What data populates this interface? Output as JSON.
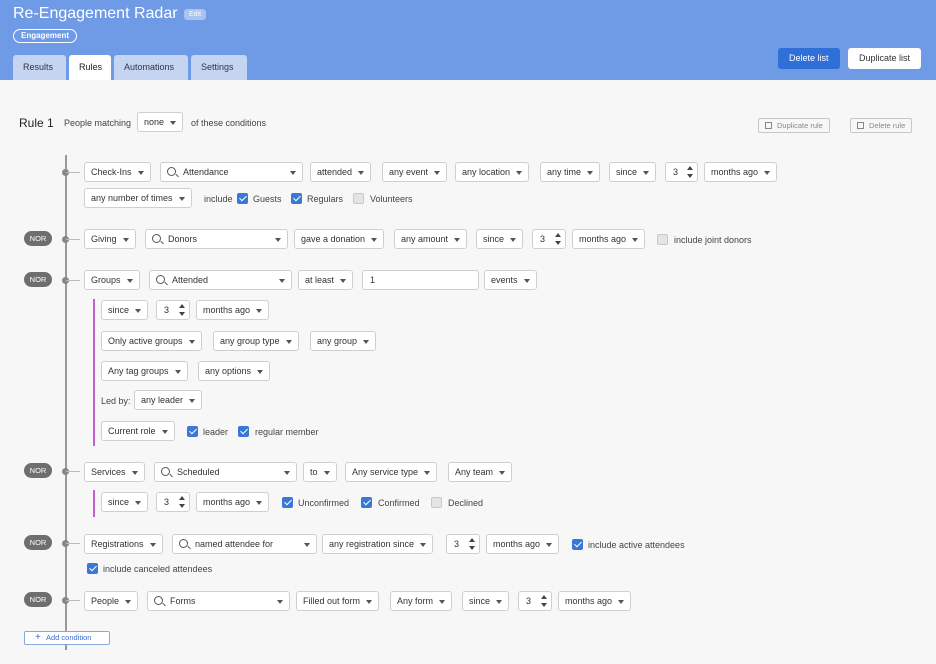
{
  "header": {
    "title": "Re-Engagement Radar",
    "edit_label": "Edit",
    "tag": "Engagement",
    "tabs": [
      "Results",
      "Rules",
      "Automations",
      "Settings"
    ],
    "delete_label": "Delete list",
    "duplicate_label": "Duplicate list"
  },
  "rule": {
    "title": "Rule 1",
    "matching_prefix": "People matching",
    "matching_value": "none",
    "matching_suffix": "of these conditions",
    "duplicate_rule": "Duplicate rule",
    "delete_rule": "Delete rule",
    "nor_label": "NOR"
  },
  "checkins": {
    "type": "Check-Ins",
    "search": "Attendance",
    "verb": "attended",
    "event": "any event",
    "location": "any location",
    "time": "any time",
    "since": "since",
    "num": "3",
    "unit": "months ago",
    "times": "any number of times",
    "include": "include",
    "guests": "Guests",
    "regulars": "Regulars",
    "volunteers": "Volunteers"
  },
  "giving": {
    "type": "Giving",
    "search": "Donors",
    "verb": "gave a donation",
    "amount": "any amount",
    "since": "since",
    "num": "3",
    "unit": "months ago",
    "joint": "include joint donors"
  },
  "groups": {
    "type": "Groups",
    "search": "Attended",
    "compare": "at least",
    "count": "1",
    "events": "events",
    "since": "since",
    "num": "3",
    "unit": "months ago",
    "active": "Only active groups",
    "group_type": "any group type",
    "group": "any group",
    "tag_groups": "Any tag groups",
    "options": "any options",
    "led_by": "Led by:",
    "leader_sel": "any leader",
    "role": "Current role",
    "leader": "leader",
    "member": "regular member"
  },
  "services": {
    "type": "Services",
    "search": "Scheduled",
    "to": "to",
    "service_type": "Any service type",
    "team": "Any team",
    "since": "since",
    "num": "3",
    "unit": "months ago",
    "unconfirmed": "Unconfirmed",
    "confirmed": "Confirmed",
    "declined": "Declined"
  },
  "registrations": {
    "type": "Registrations",
    "search": "named attendee for",
    "since_sel": "any registration since",
    "num": "3",
    "unit": "months ago",
    "active": "include active attendees",
    "canceled": "include canceled attendees"
  },
  "people": {
    "type": "People",
    "search": "Forms",
    "verb": "Filled out form",
    "form": "Any form",
    "since": "since",
    "num": "3",
    "unit": "months ago"
  },
  "add_condition": "Add condition"
}
